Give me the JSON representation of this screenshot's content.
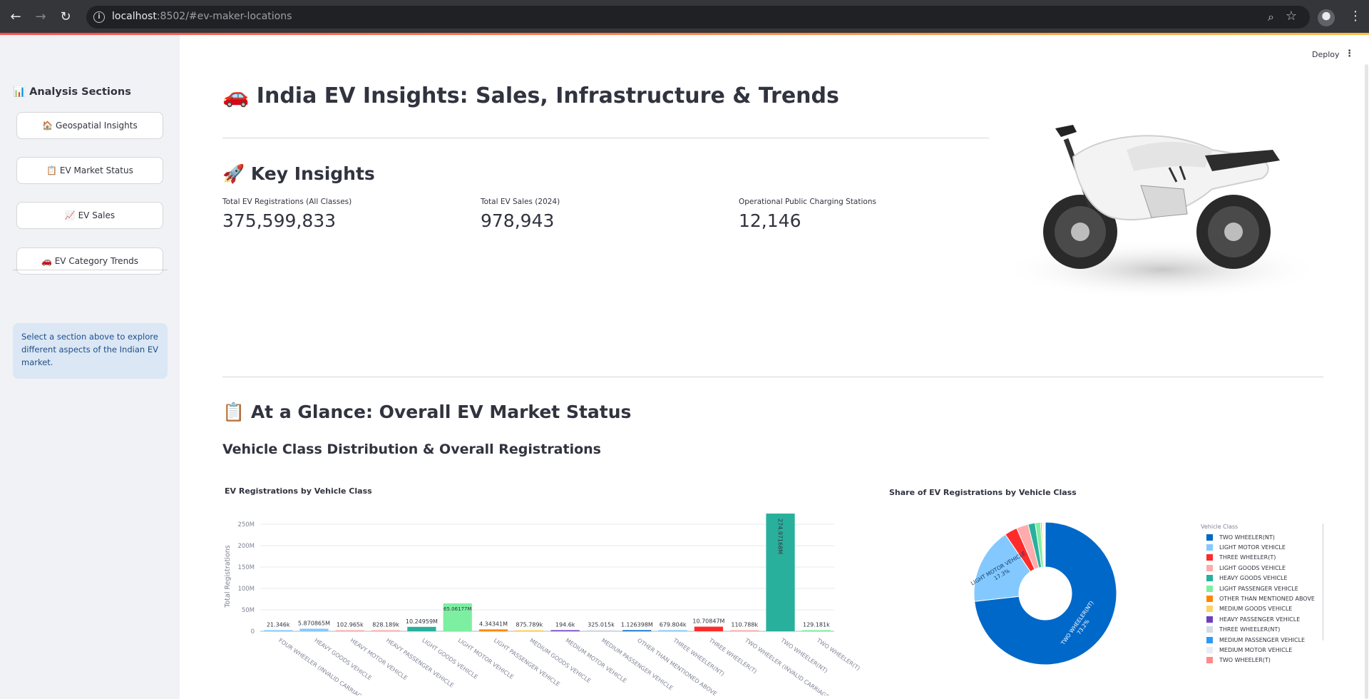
{
  "browser": {
    "url_host": "localhost",
    "url_rest": ":8502/#ev-maker-locations"
  },
  "sidebar": {
    "title": "📊 Analysis Sections",
    "buttons": [
      {
        "label": "🏠 Geospatial Insights"
      },
      {
        "label": "📋 EV Market Status"
      },
      {
        "label": "📈 EV Sales"
      },
      {
        "label": "🚗 EV Category Trends"
      }
    ],
    "info": "Select a section above to explore different aspects of the Indian EV market."
  },
  "toolbar": {
    "deploy_label": "Deploy"
  },
  "page": {
    "title": "🚗 India EV Insights: Sales, Infrastructure & Trends",
    "key_insights_heading": "🚀 Key Insights",
    "metrics": [
      {
        "label": "Total EV Registrations (All Classes)",
        "value": "375,599,833"
      },
      {
        "label": "Total EV Sales (2024)",
        "value": "978,943"
      },
      {
        "label": "Operational Public Charging Stations",
        "value": "12,146"
      }
    ],
    "glance_heading": "📋 At a Glance: Overall EV Market Status",
    "subheading": "Vehicle Class Distribution & Overall Registrations"
  },
  "colors": {
    "accent": "#ff4b4b",
    "teal": "#2bb3a0",
    "blue": "#0068c9"
  },
  "chart_data": [
    {
      "type": "bar",
      "title": "EV Registrations by Vehicle Class",
      "ylabel": "Total Registrations",
      "xlabel": "",
      "ylim": [
        0,
        275000000
      ],
      "yticks": [
        0,
        50000000,
        100000000,
        150000000,
        200000000,
        250000000
      ],
      "ytick_labels": [
        "0",
        "50M",
        "100M",
        "150M",
        "200M",
        "250M"
      ],
      "categories": [
        "FOUR WHEELER (INVALID CARRIAGE)",
        "HEAVY GOODS VEHICLE",
        "HEAVY MOTOR VEHICLE",
        "HEAVY PASSENGER VEHICLE",
        "LIGHT GOODS VEHICLE",
        "LIGHT MOTOR VEHICLE",
        "LIGHT PASSENGER VEHICLE",
        "MEDIUM GOODS VEHICLE",
        "MEDIUM MOTOR VEHICLE",
        "MEDIUM PASSENGER VEHICLE",
        "OTHER THAN MENTIONED ABOVE",
        "THREE WHEELER(NT)",
        "THREE WHEELER(T)",
        "TWO WHEELER (INVALID CARRIAGE)",
        "TWO WHEELER(NT)",
        "TWO WHEELER(T)"
      ],
      "values": [
        21346,
        5870865,
        102965,
        828189,
        10249590,
        65061770,
        4343410,
        875789,
        194600,
        325015,
        1126398,
        679804,
        10708470,
        110788,
        274971684,
        129181
      ],
      "data_labels": [
        "21.346k",
        "5.870865M",
        "102.965k",
        "828.189k",
        "10.24959M",
        "65.06177M",
        "4.34341M",
        "875.789k",
        "194.6k",
        "325.015k",
        "1.126398M",
        "679.804k",
        "10.70847M",
        "110.788k",
        "274.97168M",
        "129.181k"
      ],
      "colors": [
        "#83c9ff",
        "#83c9ff",
        "#ffabab",
        "#ffabab",
        "#29b09d",
        "#7defa1",
        "#ff8700",
        "#ffd16a",
        "#6d3fc0",
        "#d5dae5",
        "#0068c9",
        "#83c9ff",
        "#ff2b2b",
        "#ffabab",
        "#29b09d",
        "#7defa1"
      ]
    },
    {
      "type": "pie",
      "title": "Share of EV Registrations by Vehicle Class",
      "legend_title": "Vehicle Class",
      "legend_position": "right",
      "labels": [
        "TWO WHEELER(NT)",
        "LIGHT MOTOR VEHICLE",
        "THREE WHEELER(T)",
        "LIGHT GOODS VEHICLE",
        "HEAVY GOODS VEHICLE",
        "LIGHT PASSENGER VEHICLE",
        "OTHER THAN MENTIONED ABOVE",
        "MEDIUM GOODS VEHICLE",
        "HEAVY PASSENGER VEHICLE",
        "THREE WHEELER(NT)",
        "MEDIUM PASSENGER VEHICLE",
        "MEDIUM MOTOR VEHICLE",
        "TWO WHEELER(T)"
      ],
      "values": [
        73.2,
        17.3,
        2.9,
        2.7,
        1.6,
        1.2,
        0.3,
        0.2,
        0.2,
        0.2,
        0.1,
        0.05,
        0.03
      ],
      "slice_labels": [
        "TWO WHEELER(NT)\n73.2%",
        "LIGHT MOTOR VEHICLE\n17.3%",
        "",
        "",
        "",
        "",
        "",
        "",
        "",
        "",
        "",
        "",
        ""
      ],
      "colors": [
        "#0068c9",
        "#83c9ff",
        "#ff2b2b",
        "#ffabab",
        "#29b09d",
        "#7defa1",
        "#ff8700",
        "#ffd16a",
        "#6d3fc0",
        "#d5dae5",
        "#2e9bf0",
        "#e8edf5",
        "#ff8a8a"
      ]
    }
  ]
}
